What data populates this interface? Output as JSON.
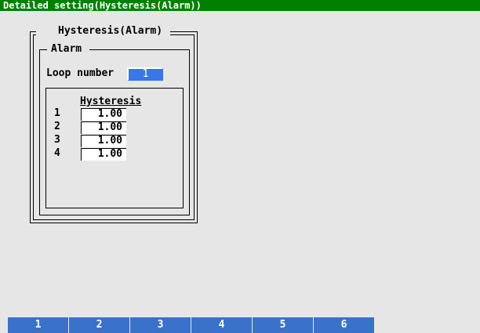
{
  "title": "Detailed setting(Hysteresis(Alarm))",
  "outer_group": {
    "legend": "Hysteresis(Alarm)"
  },
  "alarm_group": {
    "legend": "Alarm",
    "loop_number_label": "Loop number",
    "loop_number_value": "1"
  },
  "hysteresis": {
    "heading": "Hysteresis",
    "rows": [
      {
        "index": "1",
        "value": "1.00"
      },
      {
        "index": "2",
        "value": "1.00"
      },
      {
        "index": "3",
        "value": "1.00"
      },
      {
        "index": "4",
        "value": "1.00"
      }
    ]
  },
  "softkeys": [
    {
      "label": "1"
    },
    {
      "label": "2"
    },
    {
      "label": "3"
    },
    {
      "label": "4"
    },
    {
      "label": "5"
    },
    {
      "label": "6"
    }
  ],
  "colors": {
    "title_bar": "#008000",
    "background": "#e6e6e6",
    "selected_field": "#3a76e6",
    "softkey": "#3a72c9"
  }
}
